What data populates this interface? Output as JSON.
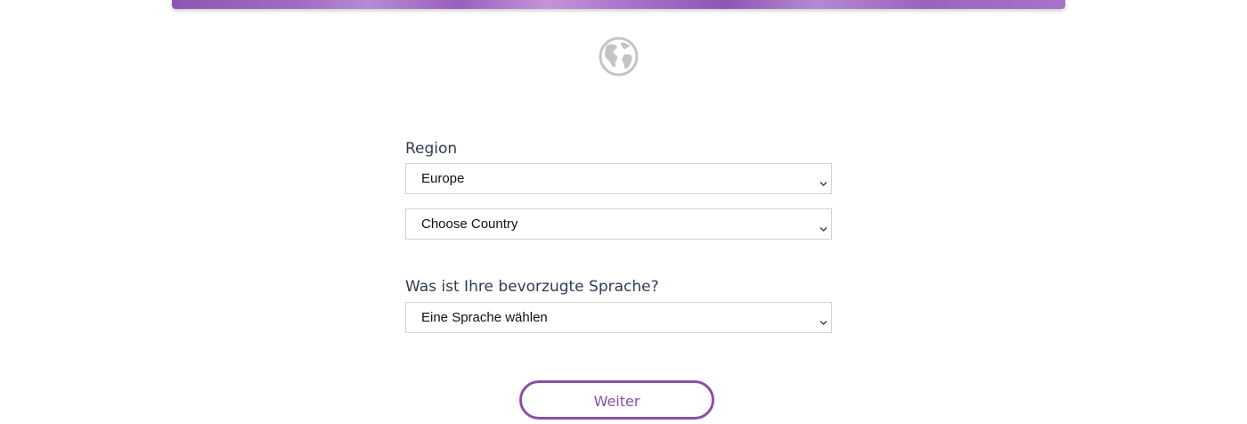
{
  "form": {
    "region_label": "Region",
    "region_value": "Europe",
    "country_value": "Choose Country",
    "language_label": "Was ist Ihre bevorzugte Sprache?",
    "language_value": "Eine Sprache wählen",
    "continue_label": "Weiter"
  },
  "icons": {
    "globe": "globe-icon",
    "dropdown": "chevron-down-icon"
  },
  "colors": {
    "accent": "#8b4fa8",
    "label_text": "#2f3d4f",
    "field_border": "#d3d3d3",
    "globe_gray": "#c4c4c4"
  }
}
